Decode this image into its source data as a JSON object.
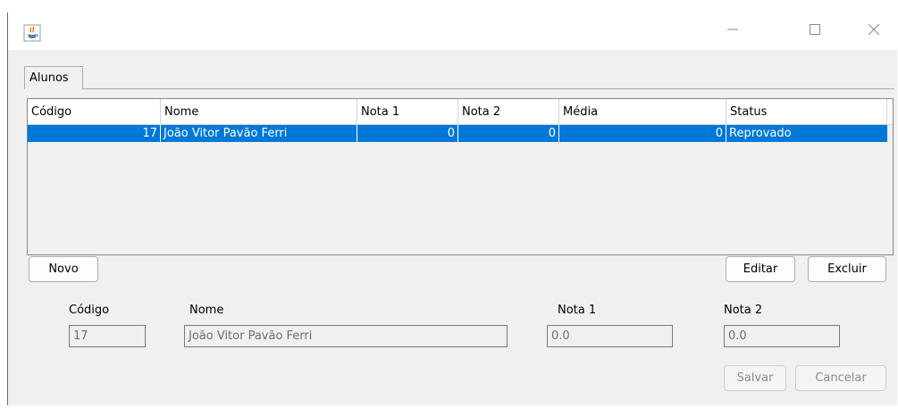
{
  "window": {
    "minimize_glyph": "—",
    "maximize_glyph": "☐",
    "close_glyph": "✕"
  },
  "tab": {
    "label": "Alunos"
  },
  "table": {
    "columns": [
      "Código",
      "Nome",
      "Nota 1",
      "Nota 2",
      "Média",
      "Status"
    ],
    "rows": [
      {
        "codigo": "17",
        "nome": "João Vitor Pavão Ferri",
        "nota1": "0",
        "nota2": "0",
        "media": "0",
        "status": "Reprovado"
      }
    ],
    "selected_color": "#0078d7"
  },
  "buttons": {
    "novo": "Novo",
    "editar": "Editar",
    "excluir": "Excluir",
    "salvar": "Salvar",
    "cancelar": "Cancelar"
  },
  "form": {
    "codigo_label": "Código",
    "nome_label": "Nome",
    "nota1_label": "Nota 1",
    "nota2_label": "Nota 2",
    "codigo_value": "17",
    "nome_value": "João Vitor Pavão Ferri",
    "nota1_value": "0.0",
    "nota2_value": "0.0"
  }
}
